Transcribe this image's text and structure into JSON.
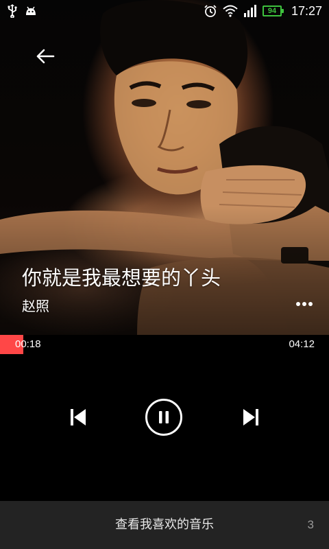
{
  "status_bar": {
    "battery_level": "94",
    "time": "17:27",
    "icons": [
      "usb-icon",
      "android-debug-icon",
      "alarm-icon",
      "wifi-icon",
      "signal-icon",
      "battery-icon"
    ],
    "battery_color": "#3ec33e"
  },
  "player": {
    "back_icon": "arrow-left-icon",
    "song_title": "你就是我最想要的丫头",
    "artist": "赵照",
    "more_icon": "more-dots-icon"
  },
  "progress": {
    "elapsed": "00:18",
    "total": "04:12",
    "fill_fraction": 0.0714,
    "fill_color": "#ff4747"
  },
  "controls": {
    "previous_icon": "skip-previous-icon",
    "pause_icon": "pause-icon",
    "next_icon": "skip-next-icon"
  },
  "bottom_bar": {
    "label": "查看我喜欢的音乐",
    "count": "3",
    "background": "#232323"
  }
}
